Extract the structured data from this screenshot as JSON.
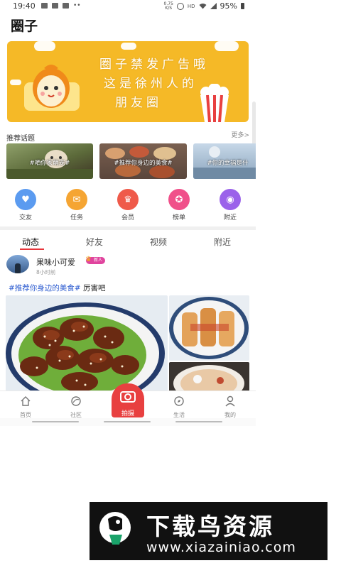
{
  "status_bar": {
    "time": "19:40",
    "net_speed_top": "0.75",
    "net_speed_unit": "K/S",
    "network": "HD",
    "battery": "95%"
  },
  "page_title": "圈子",
  "banner": {
    "line1": "圈子禁发广告哦",
    "line2": "这是徐州人的",
    "line3": "朋友圈"
  },
  "topics_section": {
    "title": "推荐话题",
    "more_label": "更多>"
  },
  "topics": [
    {
      "label": "#晒你家萌宠#"
    },
    {
      "label": "#推荐你身边的美食#"
    },
    {
      "label": "#你的幸福是什"
    }
  ],
  "quick_actions": [
    {
      "label": "交友",
      "color": "#5b9bf0",
      "icon": "heart-icon"
    },
    {
      "label": "任务",
      "color": "#f5a533",
      "icon": "task-icon"
    },
    {
      "label": "会员",
      "color": "#ef5a4a",
      "icon": "crown-icon"
    },
    {
      "label": "榜单",
      "color": "#f0508a",
      "icon": "medal-icon"
    },
    {
      "label": "附近",
      "color": "#9b62ea",
      "icon": "location-icon"
    }
  ],
  "feed_tabs": [
    "动态",
    "好友",
    "视频",
    "附近"
  ],
  "post": {
    "username": "果味小可爱",
    "badge": "新人",
    "time": "8小时前",
    "tag": "#推荐你身边的美食#",
    "text": " 厉害吧"
  },
  "bottom_nav": {
    "home": "首页",
    "community": "社区",
    "capture": "拍摄",
    "life": "生活",
    "me": "我的"
  },
  "watermark": {
    "title": "下载鸟资源",
    "url": "www.xiazainiao.com"
  },
  "colors": {
    "accent": "#e84040",
    "banner": "#f5b927",
    "tag": "#2f5ed1"
  }
}
